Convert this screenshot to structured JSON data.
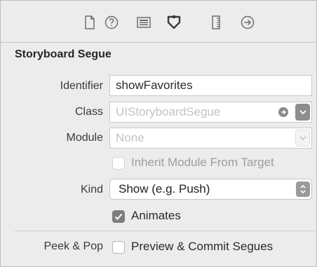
{
  "toolbar": {
    "icons": [
      "file-inspector-icon",
      "quick-help-icon",
      "identity-inspector-icon",
      "attributes-inspector-icon",
      "size-inspector-icon",
      "connections-inspector-icon"
    ],
    "selected_index": 3
  },
  "section": {
    "title": "Storyboard Segue"
  },
  "fields": {
    "identifier": {
      "label": "Identifier",
      "value": "showFavorites"
    },
    "class": {
      "label": "Class",
      "placeholder": "UIStoryboardSegue"
    },
    "module": {
      "label": "Module",
      "placeholder": "None"
    },
    "inherit": {
      "label": "Inherit Module From Target",
      "checked": false,
      "enabled": false
    },
    "kind": {
      "label": "Kind",
      "value": "Show (e.g. Push)"
    },
    "animates": {
      "label": "Animates",
      "checked": true
    },
    "peek_pop": {
      "label": "Peek & Pop",
      "option_label": "Preview & Commit Segues",
      "checked": false
    }
  },
  "colors": {
    "background": "#ececec",
    "selected_icon": "#3a3a3a",
    "icon": "#6e6e6e"
  }
}
